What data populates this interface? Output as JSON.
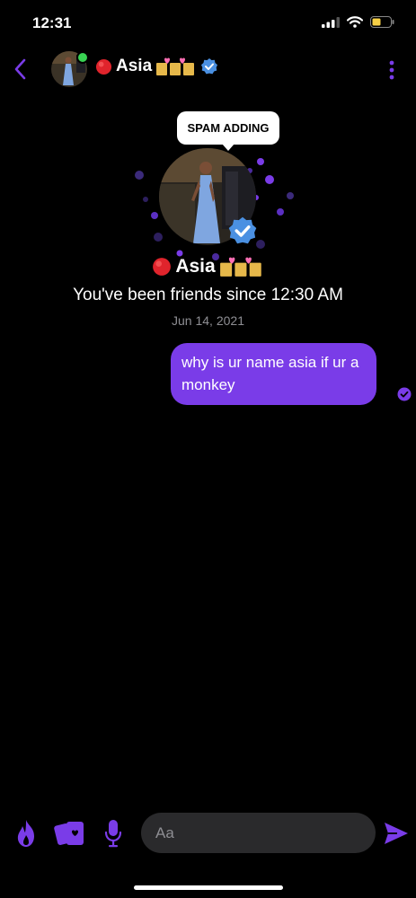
{
  "status_bar": {
    "time": "12:31",
    "icons": [
      "cellular-signal-icon",
      "wifi-icon",
      "battery-icon"
    ]
  },
  "header": {
    "back_icon": "chevron-left-icon",
    "contact_name": "Asia",
    "name_prefix_emoji": "red-circle",
    "name_suffix_emoji": "hearts-and-money-emoji",
    "verified_icon": "verified-badge-icon",
    "menu_icon": "more-vertical-icon",
    "online": true
  },
  "profile": {
    "tooltip": "SPAM ADDING",
    "name": "Asia",
    "friends_since": "You've been friends since 12:30 AM",
    "date": "Jun 14, 2021"
  },
  "messages": [
    {
      "sender": "me",
      "text": "why is ur name asia if ur a monkey",
      "status": "read"
    }
  ],
  "composer": {
    "icons": [
      "flame-icon",
      "cards-icon",
      "microphone-icon",
      "send-icon"
    ],
    "placeholder": "Aa"
  },
  "colors": {
    "accent": "#7a3ce8",
    "background": "#000000",
    "input_bg": "#2a2a2c",
    "muted": "#8e8e93",
    "verified": "#4a90e2"
  }
}
